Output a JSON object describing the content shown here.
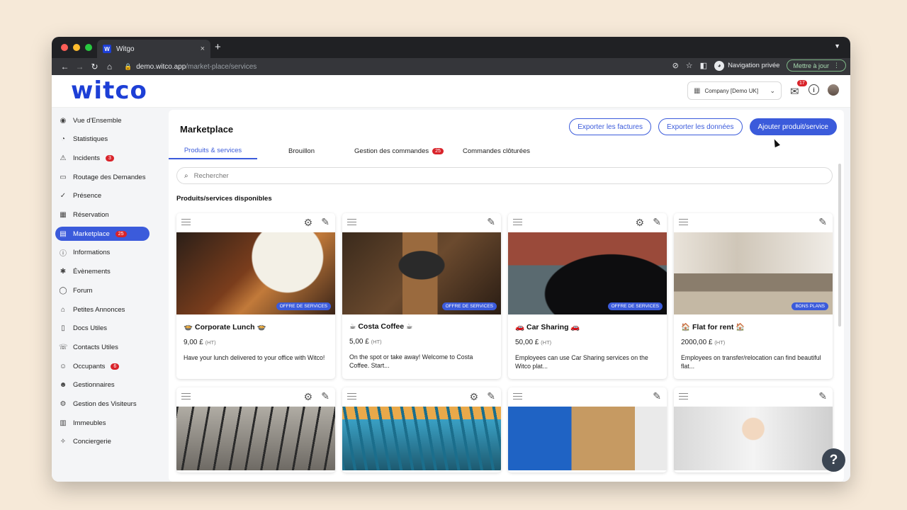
{
  "browser": {
    "tab_title": "Witgo",
    "tab_close": "×",
    "new_tab": "+",
    "url_host": "demo.witco.app",
    "url_path": "/market-place/services",
    "private_label": "Navigation privée",
    "update_label": "Mettre à jour"
  },
  "header": {
    "logo": "witco",
    "company": "Company [Demo UK]",
    "mail_count": "17"
  },
  "sidebar": {
    "items": [
      {
        "label": "Vue d'Ensemble",
        "icon": "◉",
        "badge": ""
      },
      {
        "label": "Statistiques",
        "icon": "◔",
        "badge": ""
      },
      {
        "label": "Incidents",
        "icon": "⚠",
        "badge": "3"
      },
      {
        "label": "Routage des Demandes",
        "icon": "▭",
        "badge": ""
      },
      {
        "label": "Présence",
        "icon": "✓",
        "badge": ""
      },
      {
        "label": "Réservation",
        "icon": "▦",
        "badge": ""
      },
      {
        "label": "Marketplace",
        "icon": "▤",
        "badge": "25"
      },
      {
        "label": "Informations",
        "icon": "ⓘ",
        "badge": ""
      },
      {
        "label": "Évènements",
        "icon": "✱",
        "badge": ""
      },
      {
        "label": "Forum",
        "icon": "◯",
        "badge": ""
      },
      {
        "label": "Petites Annonces",
        "icon": "⌂",
        "badge": ""
      },
      {
        "label": "Docs Utiles",
        "icon": "▯",
        "badge": ""
      },
      {
        "label": "Contacts Utiles",
        "icon": "☏",
        "badge": ""
      },
      {
        "label": "Occupants",
        "icon": "☺",
        "badge": "6"
      },
      {
        "label": "Gestionnaires",
        "icon": "☻",
        "badge": ""
      },
      {
        "label": "Gestion des Visiteurs",
        "icon": "⚙",
        "badge": ""
      },
      {
        "label": "Immeubles",
        "icon": "▥",
        "badge": ""
      },
      {
        "label": "Conciergerie",
        "icon": "✧",
        "badge": ""
      }
    ]
  },
  "main": {
    "title": "Marketplace",
    "actions": {
      "export_invoices": "Exporter les factures",
      "export_data": "Exporter les données",
      "add_product": "Ajouter produit/service"
    },
    "tabs": [
      {
        "label": "Produits & services",
        "badge": ""
      },
      {
        "label": "Brouillon",
        "badge": ""
      },
      {
        "label": "Gestion des commandes",
        "badge": "25"
      },
      {
        "label": "Commandes clôturées",
        "badge": ""
      }
    ],
    "search_placeholder": "Rechercher",
    "section_title": "Produits/services disponibles",
    "products": [
      {
        "name": "🍲 Corporate Lunch 🍲",
        "price": "9,00 £",
        "tax": "(HT)",
        "desc": "Have your lunch delivered to your office with Witco!",
        "badge": "OFFRE DE SERVICES"
      },
      {
        "name": "☕ Costa Coffee ☕",
        "price": "5,00 £",
        "tax": "(HT)",
        "desc": "On the spot or take away! Welcome to Costa Coffee. Start...",
        "badge": "OFFRE DE SERVICES"
      },
      {
        "name": "🚗 Car Sharing 🚗",
        "price": "50,00 £",
        "tax": "(HT)",
        "desc": "Employees can use Car Sharing services on the Witco plat...",
        "badge": "OFFRE DE SERVICES"
      },
      {
        "name": "🏠 Flat for rent 🏠",
        "price": "2000,00 £",
        "tax": "(HT)",
        "desc": "Employees on transfer/relocation can find beautiful flat...",
        "badge": "BONS PLANS"
      }
    ]
  },
  "help": "?"
}
